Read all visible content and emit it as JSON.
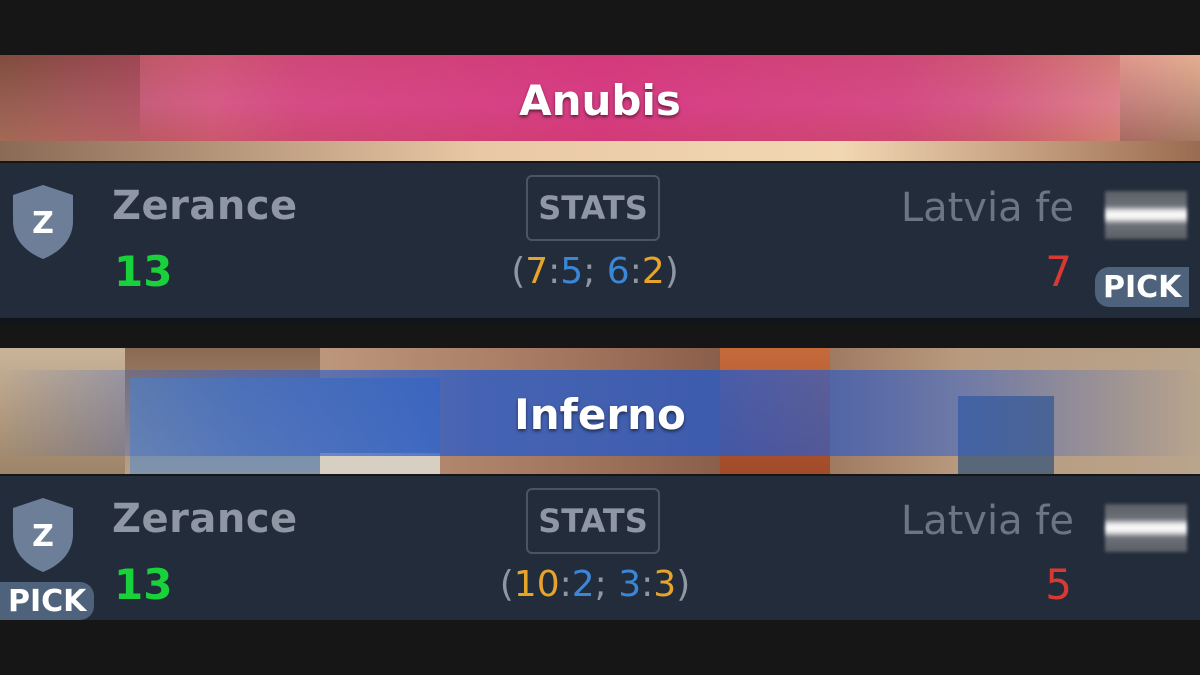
{
  "maps": [
    {
      "name": "Anubis",
      "team1": {
        "name": "Zerance",
        "logo_letter": "Z",
        "score": "13"
      },
      "team2": {
        "name": "Latvia fe",
        "score": "7"
      },
      "stats_label": "STATS",
      "half_scores": {
        "h1_t": "7",
        "h1_ct": "5",
        "h2_ct": "6",
        "h2_t": "2"
      },
      "pick_label": "PICK",
      "picked_by": "team2"
    },
    {
      "name": "Inferno",
      "team1": {
        "name": "Zerance",
        "logo_letter": "Z",
        "score": "13"
      },
      "team2": {
        "name": "Latvia fe",
        "score": "5"
      },
      "stats_label": "STATS",
      "half_scores": {
        "h1_t": "10",
        "h1_ct": "2",
        "h2_ct": "3",
        "h2_t": "3"
      },
      "pick_label": "PICK",
      "picked_by": "team1"
    }
  ],
  "colors": {
    "background": "#161616",
    "row_bg": "#232c3a",
    "win_score": "#19d23b",
    "loss_score": "#d83a33",
    "t_side": "#e6a52a",
    "ct_side": "#3b86d6",
    "anubis_band": "#d61e82",
    "inferno_band": "#285ac8"
  },
  "icons": {
    "team1_logo": "shield-icon",
    "team2_logo": "flag-icon"
  }
}
